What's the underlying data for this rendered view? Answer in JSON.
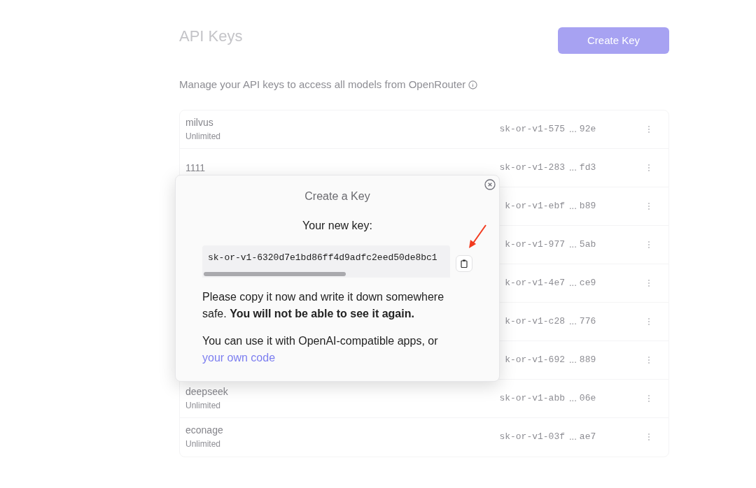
{
  "page": {
    "title": "API Keys",
    "create_button": "Create Key",
    "subtitle": "Manage your API keys to access all models from OpenRouter"
  },
  "keys": [
    {
      "name": "milvus",
      "usage": "Unlimited",
      "key_prefix": "sk-or-v1-575",
      "key_gap": "...",
      "key_suffix": "92e"
    },
    {
      "name": "1111",
      "key_prefix": "sk-or-v1-283",
      "key_gap": "...",
      "key_suffix": "fd3"
    },
    {
      "key_prefix": "k-or-v1-ebf",
      "key_gap": "...",
      "key_suffix": "b89"
    },
    {
      "key_prefix": "k-or-v1-977",
      "key_gap": "...",
      "key_suffix": "5ab"
    },
    {
      "key_prefix": "k-or-v1-4e7",
      "key_gap": "...",
      "key_suffix": "ce9"
    },
    {
      "key_prefix": "k-or-v1-c28",
      "key_gap": "...",
      "key_suffix": "776"
    },
    {
      "key_prefix": "k-or-v1-692",
      "key_gap": "...",
      "key_suffix": "889"
    },
    {
      "name": "deepseek",
      "usage": "Unlimited",
      "key_prefix": "sk-or-v1-abb",
      "key_gap": "...",
      "key_suffix": "06e"
    },
    {
      "name": "econage",
      "usage": "Unlimited",
      "key_prefix": "sk-or-v1-03f",
      "key_gap": "...",
      "key_suffix": "ae7"
    }
  ],
  "modal": {
    "title": "Create a Key",
    "heading": "Your new key:",
    "key_value": "sk-or-v1-6320d7e1bd86ff4d9adfc2eed50de8bc1",
    "warning": "Please copy it now and write it down somewhere safe. **You will not be able to see it again.**",
    "usage_text": "You can use it with OpenAI-compatible apps, or",
    "link": "your own code"
  }
}
